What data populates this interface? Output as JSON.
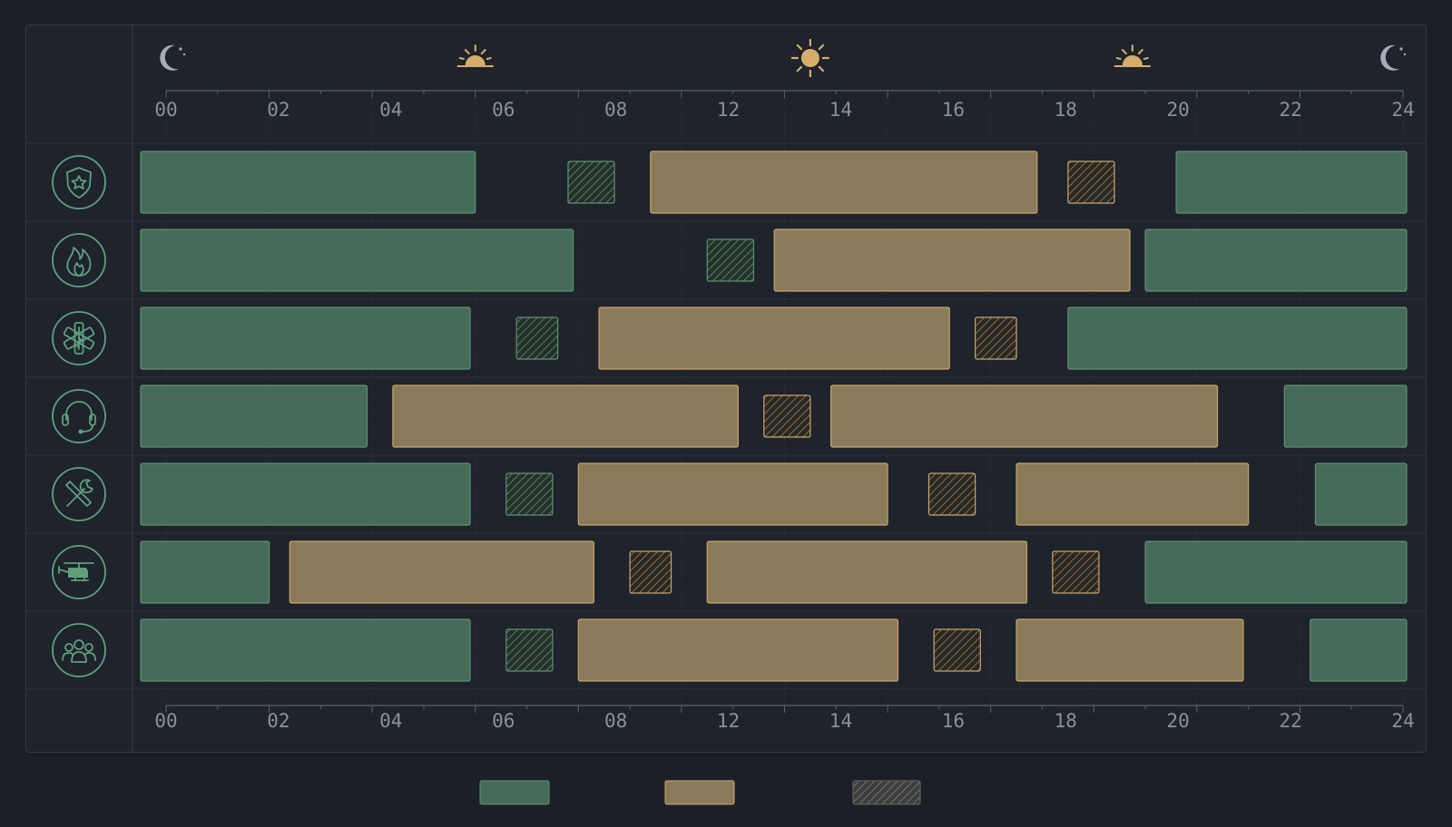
{
  "colors": {
    "background": "#1b1f27",
    "panel": "#1e232c",
    "grid": "#2d333d",
    "axis": "#5a616c",
    "tick_label": "#8a919c",
    "icon": "#5fa07f",
    "sun_icon": "#d7ad6c",
    "moon_icon": "#a7adb8",
    "green_fill": "#466b58",
    "green_stroke": "#5e9272",
    "tan_fill": "#8b7a5a",
    "tan_stroke": "#c9a56b"
  },
  "time_icons": [
    {
      "name": "moon-icon",
      "hour": 0
    },
    {
      "name": "sunrise-icon",
      "hour": 6
    },
    {
      "name": "sun-icon",
      "hour": 12.5
    },
    {
      "name": "sunset-icon",
      "hour": 18.75
    },
    {
      "name": "moon-icon",
      "hour": 24
    }
  ],
  "legend": [
    {
      "style": "green"
    },
    {
      "style": "tan"
    },
    {
      "style": "hatched"
    }
  ],
  "chart_data": {
    "type": "gantt",
    "x_unit": "hour",
    "xlim": [
      0,
      24
    ],
    "tick_labels": [
      "00",
      "02",
      "04",
      "06",
      "08",
      "12",
      "14",
      "16",
      "18",
      "20",
      "22",
      "24"
    ],
    "grid": true,
    "rows": [
      {
        "icon": "police-badge-icon",
        "segments": [
          {
            "start": 0.0,
            "end": 6.0,
            "style": "green"
          },
          {
            "start": 7.8,
            "end": 8.7,
            "style": "hatched-green"
          },
          {
            "start": 9.4,
            "end": 16.9,
            "style": "tan"
          },
          {
            "start": 17.5,
            "end": 18.4,
            "style": "hatched-tan"
          },
          {
            "start": 19.6,
            "end": 24.0,
            "style": "green"
          }
        ]
      },
      {
        "icon": "fire-icon",
        "segments": [
          {
            "start": 0.0,
            "end": 7.9,
            "style": "green"
          },
          {
            "start": 10.5,
            "end": 11.4,
            "style": "hatched-green"
          },
          {
            "start": 11.8,
            "end": 18.7,
            "style": "tan"
          },
          {
            "start": 19.0,
            "end": 24.0,
            "style": "green"
          }
        ]
      },
      {
        "icon": "medical-star-of-life-icon",
        "segments": [
          {
            "start": 0.0,
            "end": 5.9,
            "style": "green"
          },
          {
            "start": 6.8,
            "end": 7.6,
            "style": "hatched-green"
          },
          {
            "start": 8.4,
            "end": 15.2,
            "style": "tan"
          },
          {
            "start": 15.7,
            "end": 16.5,
            "style": "hatched-tan"
          },
          {
            "start": 17.5,
            "end": 24.0,
            "style": "green"
          }
        ]
      },
      {
        "icon": "headset-icon",
        "segments": [
          {
            "start": 0.0,
            "end": 3.9,
            "style": "green"
          },
          {
            "start": 4.4,
            "end": 11.1,
            "style": "tan"
          },
          {
            "start": 11.6,
            "end": 12.5,
            "style": "hatched-tan"
          },
          {
            "start": 12.9,
            "end": 20.4,
            "style": "tan"
          },
          {
            "start": 21.7,
            "end": 24.0,
            "style": "green"
          }
        ]
      },
      {
        "icon": "tools-icon",
        "segments": [
          {
            "start": 0.0,
            "end": 5.9,
            "style": "green"
          },
          {
            "start": 6.6,
            "end": 7.5,
            "style": "hatched-green"
          },
          {
            "start": 8.0,
            "end": 14.0,
            "style": "tan"
          },
          {
            "start": 14.8,
            "end": 15.7,
            "style": "hatched-tan"
          },
          {
            "start": 16.5,
            "end": 21.0,
            "style": "tan"
          },
          {
            "start": 22.3,
            "end": 24.0,
            "style": "green"
          }
        ]
      },
      {
        "icon": "helicopter-icon",
        "segments": [
          {
            "start": 0.0,
            "end": 2.0,
            "style": "green"
          },
          {
            "start": 2.4,
            "end": 8.3,
            "style": "tan"
          },
          {
            "start": 9.0,
            "end": 9.8,
            "style": "hatched-tan"
          },
          {
            "start": 10.5,
            "end": 16.7,
            "style": "tan"
          },
          {
            "start": 17.2,
            "end": 18.1,
            "style": "hatched-tan"
          },
          {
            "start": 19.0,
            "end": 24.0,
            "style": "green"
          }
        ]
      },
      {
        "icon": "team-icon",
        "segments": [
          {
            "start": 0.0,
            "end": 5.9,
            "style": "green"
          },
          {
            "start": 6.6,
            "end": 7.5,
            "style": "hatched-green"
          },
          {
            "start": 8.0,
            "end": 14.2,
            "style": "tan"
          },
          {
            "start": 14.9,
            "end": 15.8,
            "style": "hatched-tan"
          },
          {
            "start": 16.5,
            "end": 20.9,
            "style": "tan"
          },
          {
            "start": 22.2,
            "end": 24.0,
            "style": "green"
          }
        ]
      }
    ]
  }
}
